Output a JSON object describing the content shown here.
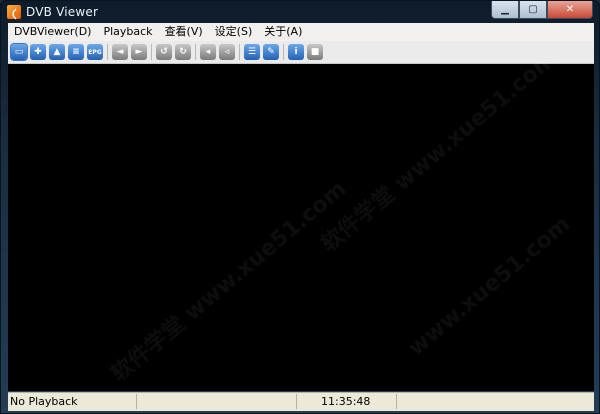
{
  "window": {
    "title": "DVB Viewer"
  },
  "caption_buttons": {
    "minimize": "▁",
    "maximize": "▢",
    "close": "✕"
  },
  "menu": [
    "DVBViewer(D)",
    "Playback",
    "查看(V)",
    "设定(S)",
    "关于(A)"
  ],
  "toolbar": [
    {
      "icon": "tv-window-icon",
      "style": "blue",
      "glyph": "▭",
      "active": true
    },
    {
      "icon": "add-channel-icon",
      "style": "blue",
      "glyph": "✚"
    },
    {
      "icon": "timer-icon",
      "style": "blue",
      "glyph": "▲"
    },
    {
      "icon": "record-list-icon",
      "style": "blue",
      "glyph": "≡"
    },
    {
      "icon": "epg-icon",
      "style": "blue",
      "glyph": "EPG"
    },
    {
      "sep": true
    },
    {
      "icon": "channel-prev-icon",
      "style": "gray",
      "glyph": "◄"
    },
    {
      "icon": "channel-next-icon",
      "style": "gray",
      "glyph": "►"
    },
    {
      "sep": true
    },
    {
      "icon": "timeshift-back-icon",
      "style": "gray",
      "glyph": "↺"
    },
    {
      "icon": "timeshift-forward-icon",
      "style": "gray",
      "glyph": "↻"
    },
    {
      "sep": true
    },
    {
      "icon": "volume-down-icon",
      "style": "gray",
      "glyph": "◂"
    },
    {
      "icon": "mute-icon",
      "style": "gray",
      "glyph": "◃"
    },
    {
      "sep": true
    },
    {
      "icon": "settings-icon",
      "style": "blue",
      "glyph": "☰"
    },
    {
      "icon": "tools-icon",
      "style": "blue",
      "glyph": "✎"
    },
    {
      "sep": true
    },
    {
      "icon": "info-icon",
      "style": "blue",
      "glyph": "i"
    },
    {
      "icon": "stop-icon",
      "style": "gray",
      "glyph": "■"
    }
  ],
  "status": {
    "text": "No Playback",
    "time": "11:35:48"
  }
}
